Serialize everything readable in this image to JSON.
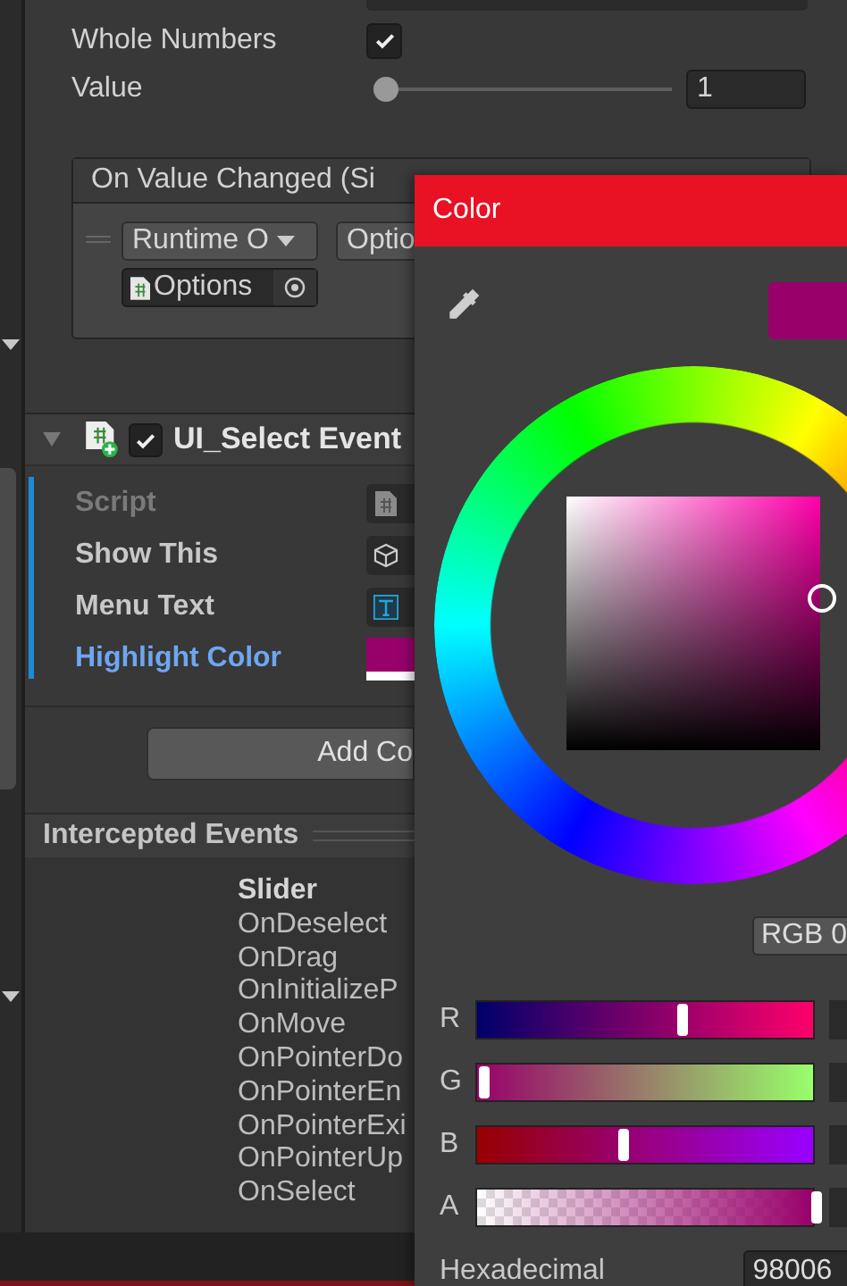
{
  "inspector": {
    "properties": [
      {
        "kind": "checkbox",
        "label": "Whole Numbers",
        "checked": true
      },
      {
        "kind": "slider",
        "label": "Value",
        "level": 0,
        "value": "1"
      }
    ],
    "event": {
      "title": "On Value Changed (Si",
      "target_dropdown": "Runtime O",
      "function_dropdown": "Optio",
      "object_field": "Options"
    },
    "component": {
      "title": "UI_Select Event",
      "enabled": true,
      "expanded": true,
      "fields": [
        {
          "kind": "script",
          "label": "Script",
          "disabled": true,
          "selected": false
        },
        {
          "kind": "object",
          "label": "Show This",
          "disabled": false,
          "selected": false
        },
        {
          "kind": "text",
          "label": "Menu Text",
          "disabled": false,
          "selected": false
        },
        {
          "kind": "color",
          "label": "Highlight Color",
          "color": "#98006a",
          "disabled": false,
          "selected": true
        }
      ]
    },
    "add_button": "Add Co",
    "intercepted": {
      "title": "Intercepted Events",
      "groups": [
        {
          "name": "Slider",
          "events": [
            "OnDeselect",
            "OnDrag",
            "OnInitializeP",
            "OnMove",
            "OnPointerDo",
            "OnPointerEn",
            "OnPointerExi",
            "OnPointerUp",
            "OnSelect"
          ]
        }
      ]
    }
  },
  "color_window": {
    "title": "Color",
    "color": "#98006a",
    "mode_button": "RGB 0",
    "channels": [
      {
        "label": "R",
        "level": 0.596
      },
      {
        "label": "G",
        "level": 0
      },
      {
        "label": "B",
        "level": 0.416
      },
      {
        "label": "A",
        "level": 1
      }
    ],
    "hex_label": "Hexadecimal",
    "hex_value": "98006"
  }
}
